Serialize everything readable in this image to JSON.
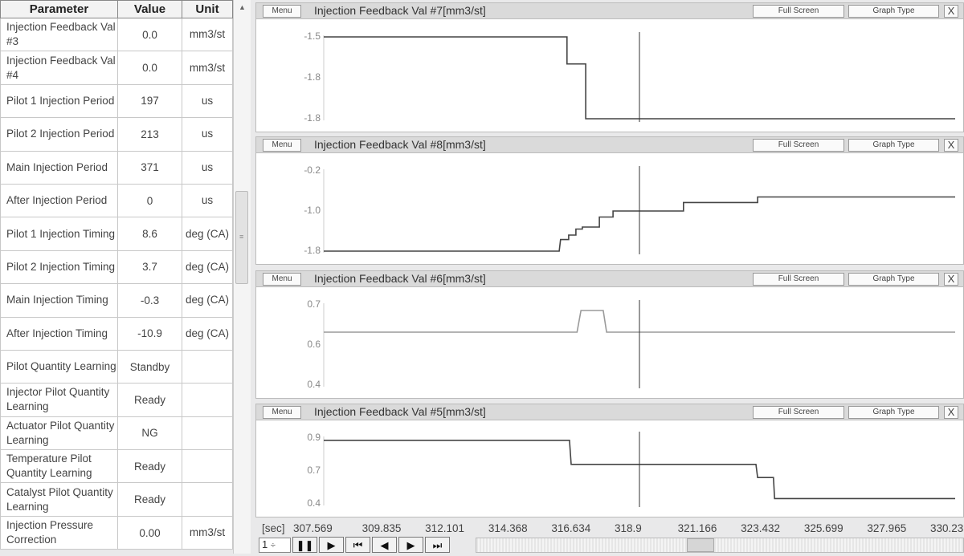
{
  "table": {
    "headers": {
      "parameter": "Parameter",
      "value": "Value",
      "unit": "Unit"
    },
    "rows": [
      {
        "parameter": "Injection Feedback Val #3",
        "value": "0.0",
        "unit": "mm3/st"
      },
      {
        "parameter": "Injection Feedback Val #4",
        "value": "0.0",
        "unit": "mm3/st"
      },
      {
        "parameter": "Pilot 1 Injection Period",
        "value": "197",
        "unit": "us"
      },
      {
        "parameter": "Pilot 2 Injection Period",
        "value": "213",
        "unit": "us"
      },
      {
        "parameter": "Main Injection Period",
        "value": "371",
        "unit": "us"
      },
      {
        "parameter": "After Injection Period",
        "value": "0",
        "unit": "us"
      },
      {
        "parameter": "Pilot 1 Injection Timing",
        "value": "8.6",
        "unit": "deg (CA)"
      },
      {
        "parameter": "Pilot 2 Injection Timing",
        "value": "3.7",
        "unit": "deg (CA)"
      },
      {
        "parameter": "Main Injection Timing",
        "value": "-0.3",
        "unit": "deg (CA)"
      },
      {
        "parameter": "After Injection Timing",
        "value": "-10.9",
        "unit": "deg (CA)"
      },
      {
        "parameter": "Pilot Quantity Learning",
        "value": "Standby",
        "unit": ""
      },
      {
        "parameter": "Injector Pilot Quantity Learning",
        "value": "Ready",
        "unit": ""
      },
      {
        "parameter": "Actuator Pilot Quantity Learning",
        "value": "NG",
        "unit": ""
      },
      {
        "parameter": "Temperature Pilot Quantity Learning",
        "value": "Ready",
        "unit": ""
      },
      {
        "parameter": "Catalyst Pilot Quantity Learning",
        "value": "Ready",
        "unit": ""
      },
      {
        "parameter": "Injection Pressure Correction",
        "value": "0.00",
        "unit": "mm3/st"
      }
    ]
  },
  "buttons": {
    "menu": "Menu",
    "full_screen": "Full Screen",
    "graph_type": "Graph Type",
    "close": "X"
  },
  "graphs": [
    {
      "title": "Injection Feedback Val #7[mm3/st]",
      "ticks": [
        "-1.5",
        "-1.8",
        "-1.8"
      ],
      "ylim": [
        -2.0,
        -1.5
      ],
      "color": "#444444",
      "points": [
        [
          307.569,
          -1.5
        ],
        [
          316.3,
          -1.5
        ],
        [
          316.3,
          -1.665
        ],
        [
          316.97,
          -1.665
        ],
        [
          316.97,
          -2.0
        ],
        [
          330.231,
          -2.0
        ]
      ]
    },
    {
      "title": "Injection Feedback Val #8[mm3/st]",
      "ticks": [
        "-0.2",
        "-1.0",
        "-1.8"
      ],
      "ylim": [
        -1.8,
        -0.2
      ],
      "color": "#444444",
      "points": [
        [
          307.569,
          -1.8
        ],
        [
          316.02,
          -1.8
        ],
        [
          316.07,
          -1.57
        ],
        [
          316.36,
          -1.57
        ],
        [
          316.36,
          -1.48
        ],
        [
          316.62,
          -1.48
        ],
        [
          316.62,
          -1.36
        ],
        [
          316.85,
          -1.36
        ],
        [
          316.85,
          -1.32
        ],
        [
          317.46,
          -1.32
        ],
        [
          317.46,
          -1.12
        ],
        [
          317.95,
          -1.12
        ],
        [
          317.95,
          -1.0
        ],
        [
          320.48,
          -1.0
        ],
        [
          320.48,
          -0.83
        ],
        [
          323.14,
          -0.83
        ],
        [
          323.14,
          -0.72
        ],
        [
          330.231,
          -0.72
        ]
      ]
    },
    {
      "title": "Injection Feedback Val #6[mm3/st]",
      "ticks": [
        "0.7",
        "0.6",
        "0.4"
      ],
      "ylim": [
        0.4,
        0.7
      ],
      "color": "#9a9a9a",
      "points": [
        [
          307.569,
          0.598
        ],
        [
          316.66,
          0.598
        ],
        [
          316.8,
          0.679
        ],
        [
          317.6,
          0.679
        ],
        [
          317.72,
          0.598
        ],
        [
          330.231,
          0.598
        ]
      ]
    },
    {
      "title": "Injection Feedback Val #5[mm3/st]",
      "ticks": [
        "0.9",
        "0.7",
        "0.4"
      ],
      "ylim": [
        0.4,
        0.9
      ],
      "color": "#444444",
      "points": [
        [
          307.569,
          0.883
        ],
        [
          316.39,
          0.883
        ],
        [
          316.45,
          0.7
        ],
        [
          323.08,
          0.7
        ],
        [
          323.14,
          0.6
        ],
        [
          323.71,
          0.6
        ],
        [
          323.75,
          0.44
        ],
        [
          330.231,
          0.44
        ]
      ]
    }
  ],
  "cursor_time": 318.9,
  "time_axis": {
    "unit": "[sec]",
    "ticks": [
      "307.569",
      "309.835",
      "312.101",
      "314.368",
      "316.634",
      "318.9",
      "321.166",
      "323.432",
      "325.699",
      "327.965",
      "330.231"
    ],
    "range": [
      307.569,
      330.231
    ]
  },
  "controls": {
    "speed": "1",
    "spin": "÷",
    "pause": "❚❚",
    "play": "▶",
    "first": "⏮",
    "prev": "◀",
    "next": "▶",
    "last": "⏭"
  }
}
